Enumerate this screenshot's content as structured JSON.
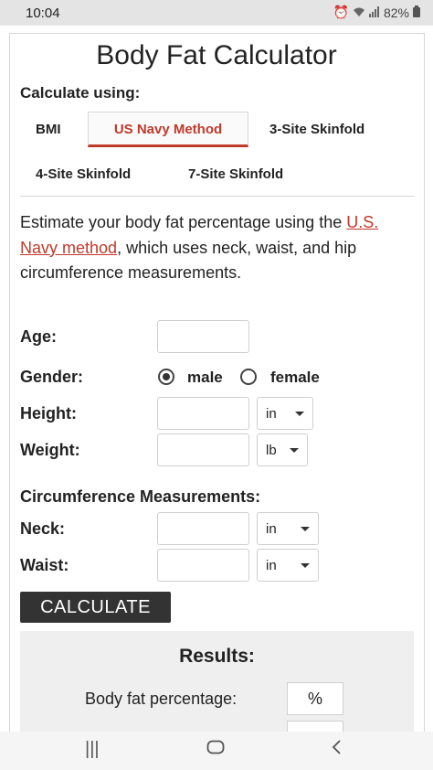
{
  "status": {
    "time": "10:04",
    "battery": "82%",
    "icons": [
      "alarm-icon",
      "wifi-icon",
      "signal-icon",
      "battery-icon"
    ]
  },
  "page": {
    "title": "Body Fat Calculator",
    "calc_using": "Calculate using:"
  },
  "tabs": [
    {
      "label": "BMI",
      "active": false
    },
    {
      "label": "US Navy Method",
      "active": true
    },
    {
      "label": "3-Site Skinfold",
      "active": false
    },
    {
      "label": "4-Site Skinfold",
      "active": false
    },
    {
      "label": "7-Site Skinfold",
      "active": false
    }
  ],
  "description": {
    "before": "Estimate your body fat percentage using the ",
    "link": "U.S. Navy method",
    "after": ", which uses neck, waist, and hip circumference measurements."
  },
  "form": {
    "age_label": "Age:",
    "age_value": "",
    "gender_label": "Gender:",
    "gender_options": [
      {
        "label": "male",
        "selected": true
      },
      {
        "label": "female",
        "selected": false
      }
    ],
    "height_label": "Height:",
    "height_unit": "in",
    "weight_label": "Weight:",
    "weight_unit": "lb",
    "circ_heading": "Circumference Measurements:",
    "neck_label": "Neck:",
    "neck_unit": "in",
    "waist_label": "Waist:",
    "waist_unit": "in",
    "calculate_label": "CALCULATE"
  },
  "results": {
    "title": "Results:",
    "body_fat_label": "Body fat percentage:",
    "body_fat_unit": "%"
  },
  "navbar": {
    "recent": "|||",
    "home": "○",
    "back": "<"
  }
}
